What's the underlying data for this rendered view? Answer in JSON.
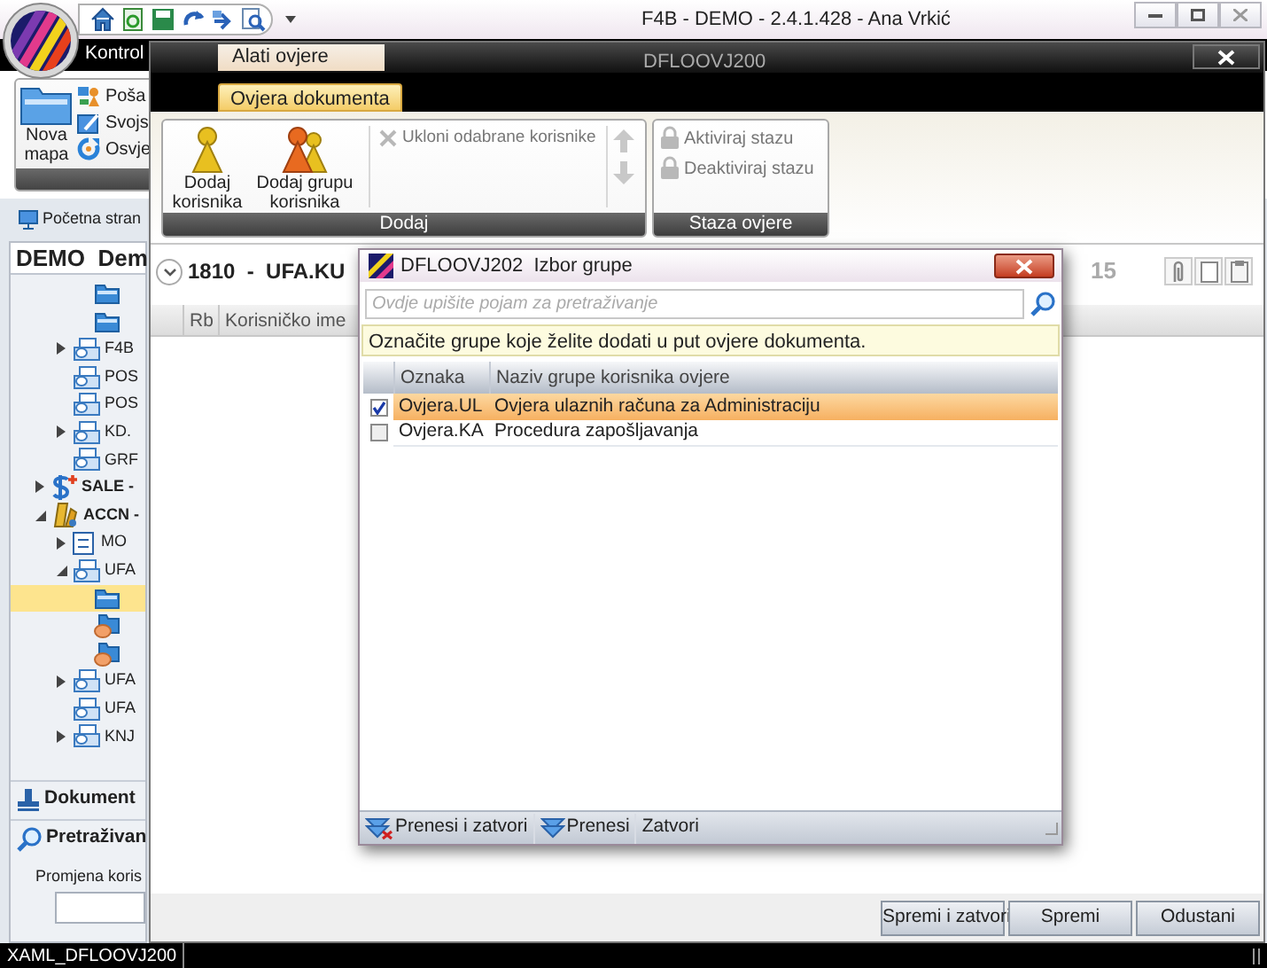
{
  "app": {
    "title": "F4B - DEMO - 2.4.1.428 - Ana  Vrkić",
    "ribbon_tab": "Kontrol",
    "ribbon_buttons": [
      {
        "label": "Nova mapa",
        "kind": "large"
      },
      {
        "label": "Poša",
        "kind": "share"
      },
      {
        "label": "Svojs",
        "kind": "properties"
      },
      {
        "label": "Osvje",
        "kind": "refresh"
      }
    ]
  },
  "navigation": {
    "tab": "Početna stran",
    "header": "DEMO  Dem",
    "tree": [
      {
        "children": [
          {
            "children": [
              {
                "kind": "folder",
                "selected": false
              },
              {
                "kind": "folder",
                "selected": false
              }
            ]
          },
          {
            "kind": "stack",
            "label": "F4B",
            "expanded": false,
            "selected": false
          },
          {
            "kind": "stack",
            "label": "POS",
            "selected": false
          },
          {
            "kind": "stack",
            "label": "POS",
            "selected": false
          },
          {
            "kind": "stack",
            "label": "KD.",
            "expanded": false,
            "selected": false
          },
          {
            "kind": "stack",
            "label": "GRF",
            "selected": false
          }
        ]
      },
      {
        "kind": "sale",
        "label": "SALE -",
        "expanded": false,
        "selected": false
      },
      {
        "kind": "accn",
        "label": "ACCN -",
        "expanded": true,
        "selected": false,
        "children": [
          {
            "kind": "form",
            "label": "MO",
            "expanded": false,
            "selected": false
          },
          {
            "kind": "stack",
            "label": "UFA",
            "expanded": true,
            "selected": false,
            "children": [
              {
                "kind": "folder",
                "selected": true
              },
              {
                "kind": "hand",
                "selected": false
              },
              {
                "kind": "hand",
                "selected": false
              }
            ]
          },
          {
            "kind": "stack",
            "label": "UFA",
            "expanded": false,
            "selected": false
          },
          {
            "kind": "stack",
            "label": "UFA",
            "selected": false
          },
          {
            "kind": "stack",
            "label": "KNJ",
            "expanded": false,
            "selected": false
          }
        ]
      }
    ],
    "sections": [
      {
        "label": "Dokument",
        "kind": "stamp"
      },
      {
        "label": "Pretraživan",
        "kind": "search"
      }
    ],
    "filter_label": "Promjena koris"
  },
  "status_bar": {
    "text": "XAML_DFLOOVJ200"
  },
  "document_window": {
    "title": "DFLOOVJ200",
    "context_group": "Alati ovjere",
    "tabs": [
      {
        "label": "Ovjera dokumenta",
        "selected": true
      }
    ],
    "ribbon_groups": [
      {
        "title": "Dodaj",
        "buttons": [
          {
            "kind": "user",
            "label": "Dodaj korisnika",
            "disabled": false
          },
          {
            "kind": "group",
            "label": "Dodaj grupu korisnika",
            "disabled": false
          },
          {
            "kind": "remove",
            "label": "Ukloni odabrane korisnike",
            "disabled": true
          },
          {
            "kind": "move",
            "disabled": true
          }
        ]
      },
      {
        "title": "Staza ovjere",
        "buttons": [
          {
            "kind": "lock",
            "label": "Aktiviraj stazu",
            "disabled": true
          },
          {
            "kind": "lock",
            "label": "Deaktiviraj stazu",
            "disabled": true
          }
        ]
      }
    ],
    "heading": "1810  -  UFA.KU",
    "count": "15",
    "columns": [
      "Rb",
      "Korisničko ime"
    ],
    "buttons": [
      "Spremi i zatvori",
      "Spremi",
      "Odustani"
    ]
  },
  "dialog": {
    "title": "DFLOOVJ202  Izbor grupe",
    "search_placeholder": "Ovdje upišite pojam za pretraživanje",
    "hint": "Označite grupe koje želite dodati u put ovjere dokumenta.",
    "columns": [
      "Oznaka",
      "Naziv grupe korisnika ovjere"
    ],
    "rows": [
      {
        "code": "Ovjera.UL",
        "name": "Ovjera ulaznih računa za Administraciju",
        "checked": true,
        "selected": true
      },
      {
        "code": "Ovjera.KA",
        "name": "Procedura zapošljavanja",
        "checked": false,
        "selected": false
      }
    ],
    "toolbar": [
      {
        "kind": "transfer-close",
        "label": "Prenesi i zatvori"
      },
      {
        "kind": "transfer",
        "label": "Prenesi"
      },
      {
        "kind": "plain",
        "label": "Zatvori"
      }
    ]
  }
}
